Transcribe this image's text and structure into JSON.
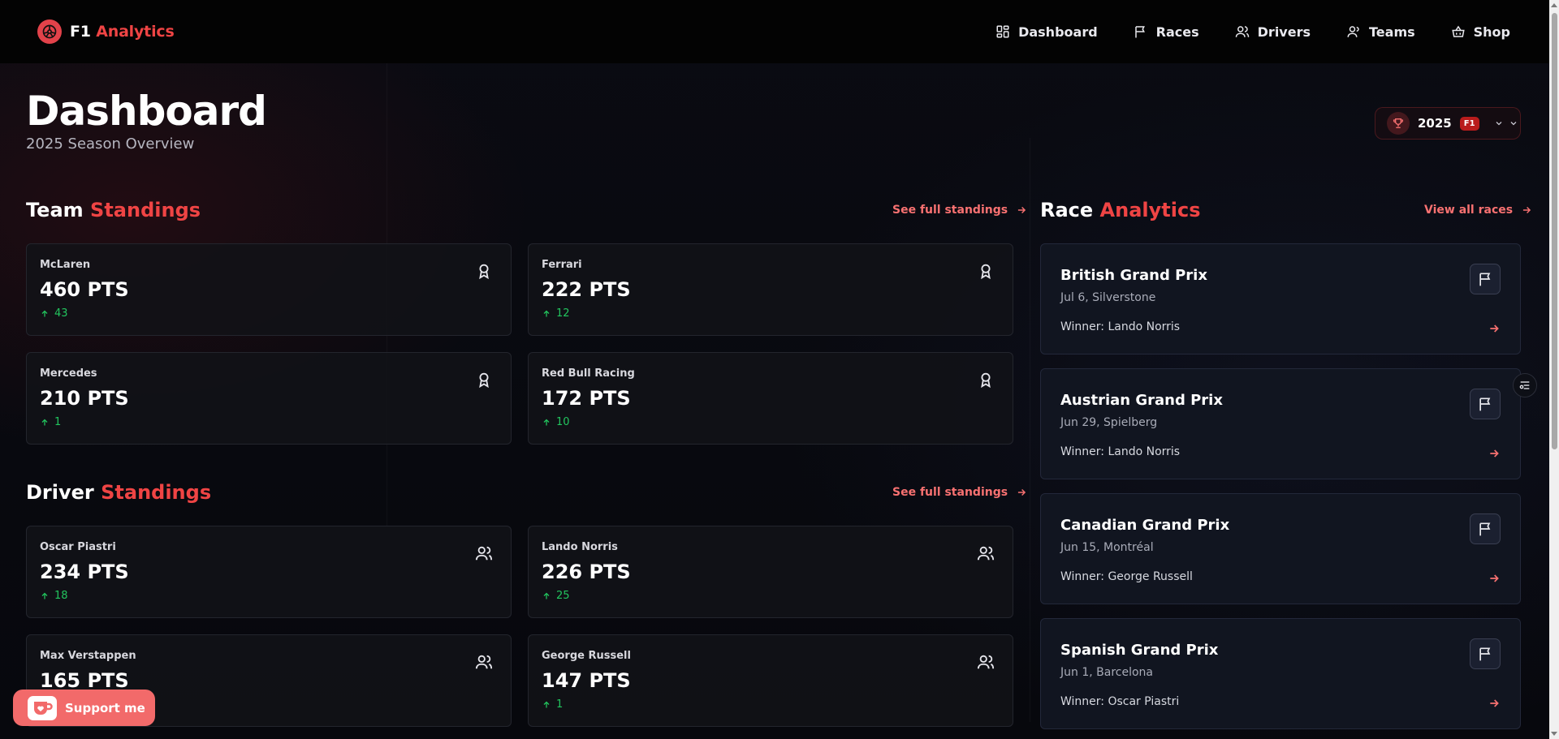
{
  "brand": {
    "f1": "F1",
    "name": "Analytics",
    "accent": "#ef4444"
  },
  "nav": [
    {
      "label": "Dashboard",
      "icon": "dashboard-icon"
    },
    {
      "label": "Races",
      "icon": "flag-icon"
    },
    {
      "label": "Drivers",
      "icon": "users-icon"
    },
    {
      "label": "Teams",
      "icon": "user-icon"
    },
    {
      "label": "Shop",
      "icon": "basket-icon"
    }
  ],
  "page": {
    "title": "Dashboard",
    "subtitle": "2025 Season Overview"
  },
  "season_select": {
    "year": "2025",
    "tag": "F1"
  },
  "team_standings": {
    "title_main": "Team",
    "title_accent": "Standings",
    "link": "See full standings",
    "cards": [
      {
        "name": "McLaren",
        "points": "460 PTS",
        "change": "43"
      },
      {
        "name": "Ferrari",
        "points": "222 PTS",
        "change": "12"
      },
      {
        "name": "Mercedes",
        "points": "210 PTS",
        "change": "1"
      },
      {
        "name": "Red Bull Racing",
        "points": "172 PTS",
        "change": "10"
      }
    ]
  },
  "driver_standings": {
    "title_main": "Driver",
    "title_accent": "Standings",
    "link": "See full standings",
    "cards": [
      {
        "name": "Oscar Piastri",
        "points": "234 PTS",
        "change": "18"
      },
      {
        "name": "Lando Norris",
        "points": "226 PTS",
        "change": "25"
      },
      {
        "name": "Max Verstappen",
        "points": "165 PTS",
        "change": ""
      },
      {
        "name": "George Russell",
        "points": "147 PTS",
        "change": "1"
      }
    ]
  },
  "race_analytics": {
    "title_main": "Race",
    "title_accent": "Analytics",
    "link": "View all races",
    "races": [
      {
        "name": "British Grand Prix",
        "meta": "Jul 6, Silverstone",
        "winner": "Winner: Lando Norris"
      },
      {
        "name": "Austrian Grand Prix",
        "meta": "Jun 29, Spielberg",
        "winner": "Winner: Lando Norris"
      },
      {
        "name": "Canadian Grand Prix",
        "meta": "Jun 15, Montréal",
        "winner": "Winner: George Russell"
      },
      {
        "name": "Spanish Grand Prix",
        "meta": "Jun 1, Barcelona",
        "winner": "Winner: Oscar Piastri"
      }
    ]
  },
  "support": {
    "label": "Support me"
  },
  "colors": {
    "positive": "#22c55e",
    "accent": "#ef4444",
    "support_bg": "#f26a6a"
  }
}
